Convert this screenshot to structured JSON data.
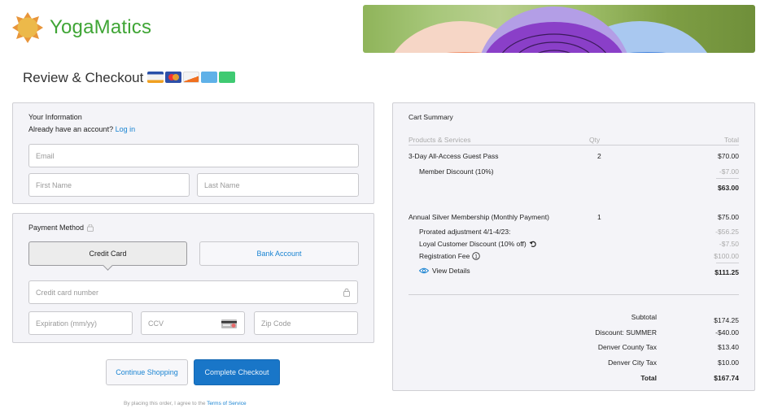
{
  "brand": {
    "name": "YogaMatics",
    "logo_icon": "sun-icon",
    "accent": "#3fa535"
  },
  "header": {
    "title": "Review & Checkout",
    "payment_logos": [
      "visa",
      "mastercard",
      "discover",
      "amex",
      "generic-card"
    ]
  },
  "your_information": {
    "heading": "Your Information",
    "account_prompt": "Already have an account?",
    "login_link": "Log in",
    "email_placeholder": "Email",
    "first_name_placeholder": "First Name",
    "last_name_placeholder": "Last Name"
  },
  "payment_method": {
    "heading": "Payment Method",
    "heading_icon": "lock-icon",
    "tabs": [
      {
        "label": "Credit Card",
        "active": true
      },
      {
        "label": "Bank Account",
        "active": false
      }
    ],
    "card_number_placeholder": "Credit card number",
    "expiration_placeholder": "Expiration (mm/yy)",
    "ccv_placeholder": "CCV",
    "zip_placeholder": "Zip Code"
  },
  "actions": {
    "continue_label": "Continue Shopping",
    "checkout_label": "Complete Checkout",
    "terms_prefix": "By placing this order, I agree to the",
    "terms_link": "Terms of Service"
  },
  "cart": {
    "heading": "Cart Summary",
    "columns": {
      "product": "Products & Services",
      "qty": "Qty",
      "total": "Total"
    },
    "items": [
      {
        "name": "3-Day All-Access Guest Pass",
        "qty": "2",
        "price": "$70.00",
        "adjustments": [
          {
            "label": "Member Discount (10%)",
            "amount": "-$7.00"
          }
        ],
        "line_total": "$63.00"
      },
      {
        "name": "Annual Silver Membership (Monthly Payment)",
        "qty": "1",
        "price": "$75.00",
        "adjustments": [
          {
            "label": "Prorated adjustment 4/1-4/23:",
            "amount": "-$56.25"
          },
          {
            "label": "Loyal Customer Discount (10% off)",
            "amount": "-$7.50"
          },
          {
            "label": "Registration Fee",
            "amount": "$100.00"
          }
        ],
        "view_details": "View Details",
        "line_total": "$111.25"
      }
    ],
    "summary": [
      {
        "label": "Subtotal",
        "value": "$174.25"
      },
      {
        "label": "Discount: SUMMER",
        "value": "-$40.00"
      },
      {
        "label": "Denver County Tax",
        "value": "$13.40"
      },
      {
        "label": "Denver City Tax",
        "value": "$10.00"
      },
      {
        "label": "Total",
        "value": "$167.74"
      }
    ]
  }
}
